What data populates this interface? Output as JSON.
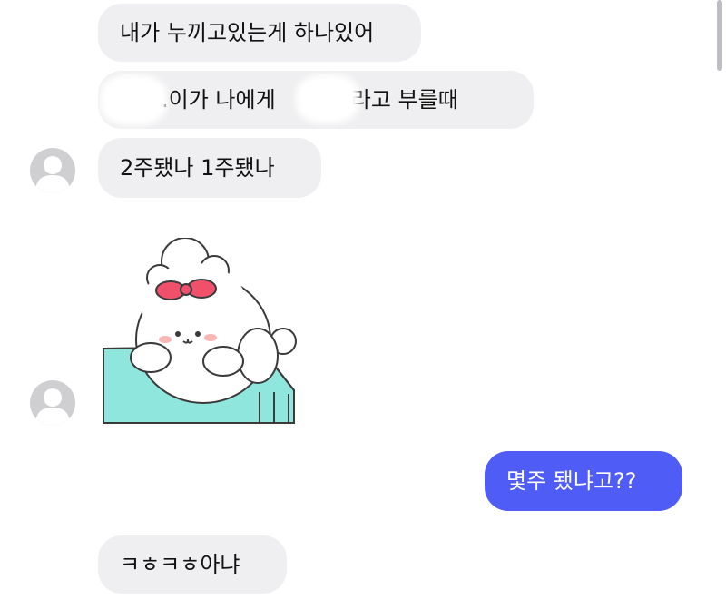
{
  "messages": [
    {
      "id": "m1",
      "text": "내가 누끼고있는게 하나있어",
      "side": "received"
    },
    {
      "id": "m2",
      "text": ".이가 나에게       야 라고 부를때",
      "side": "received"
    },
    {
      "id": "m3",
      "text": "2주됐나 1주됐나",
      "side": "received"
    },
    {
      "id": "m4",
      "side": "received",
      "sticker": "white-puppy-with-red-bow-sticker"
    },
    {
      "id": "m5",
      "text": "몇주 됐냐고??",
      "side": "sent"
    },
    {
      "id": "m6",
      "text": "ㅋㅎㅋㅎ아냐",
      "side": "received"
    }
  ],
  "colors": {
    "received_bubble": "#efeff1",
    "sent_bubble": "#4f5cf5",
    "avatar": "#cfcfd2",
    "sticker_table": "#8fe6dc",
    "sticker_bow": "#f0506a"
  }
}
